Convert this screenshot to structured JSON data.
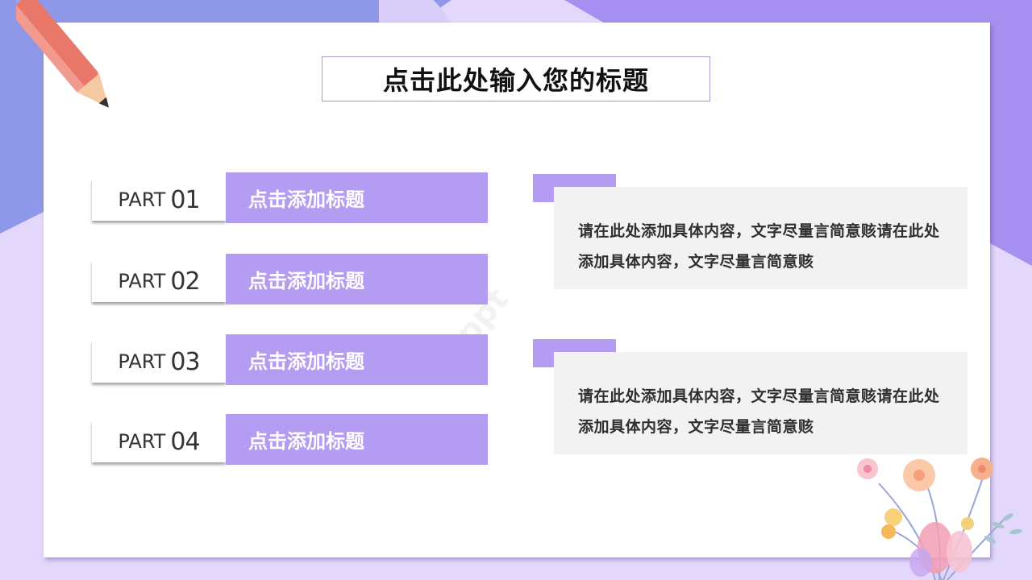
{
  "slide": {
    "title": "点击此处输入您的标题",
    "colors": {
      "accent": "#b59cf3",
      "background": "#e3d8fb",
      "card": "#ffffff",
      "text_box": "#f2f2f2"
    }
  },
  "parts": [
    {
      "word": "PART",
      "number": "01",
      "heading": "点击添加标题"
    },
    {
      "word": "PART",
      "number": "02",
      "heading": "点击添加标题"
    },
    {
      "word": "PART",
      "number": "03",
      "heading": "点击添加标题"
    },
    {
      "word": "PART",
      "number": "04",
      "heading": "点击添加标题"
    }
  ],
  "content_blocks": [
    {
      "text": "请在此处添加具体内容，文字尽量言简意赅请在此处添加具体内容，文字尽量言简意赅"
    },
    {
      "text": "请在此处添加具体内容，文字尽量言简意赅请在此处添加具体内容，文字尽量言简意赅"
    }
  ],
  "decorations": {
    "pencil_icon": "pencil-icon",
    "flower_icon": "flower-bouquet-icon"
  }
}
